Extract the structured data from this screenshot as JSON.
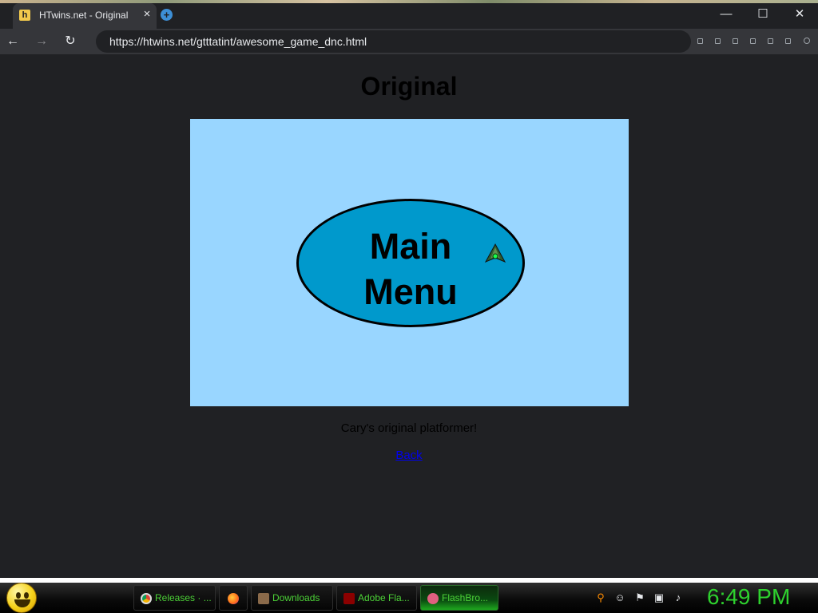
{
  "browser": {
    "tab_title": "HTwins.net - Original",
    "tab_favicon": "h",
    "url": "https://htwins.net/gtttatint/awesome_game_dnc.html",
    "icons": {
      "close_tab": "×",
      "new_tab": "+",
      "minimize": "—",
      "maximize": "☐",
      "close_window": "✕",
      "back": "←",
      "forward": "→",
      "reload": "↻"
    }
  },
  "page": {
    "title": "Original",
    "game": {
      "menu_line1": "Main",
      "menu_line2": "Menu",
      "background_color": "#99d6ff",
      "oval_color": "#0099cc"
    },
    "caption": "Cary's original platformer!",
    "back_link": "Back"
  },
  "taskbar": {
    "items": [
      {
        "label": "Releases · ...",
        "icon": "chrome-icon"
      },
      {
        "label": "",
        "icon": "firefox-icon"
      },
      {
        "label": "Downloads",
        "icon": "downloads-icon"
      },
      {
        "label": "Adobe Fla...",
        "icon": "flash-icon"
      },
      {
        "label": "FlashBro...",
        "icon": "flashbrowser-icon"
      }
    ],
    "tray_icons": [
      "search-icon",
      "smile-icon",
      "flag-icon",
      "network-icon",
      "volume-icon"
    ],
    "clock": "6:49 PM"
  }
}
